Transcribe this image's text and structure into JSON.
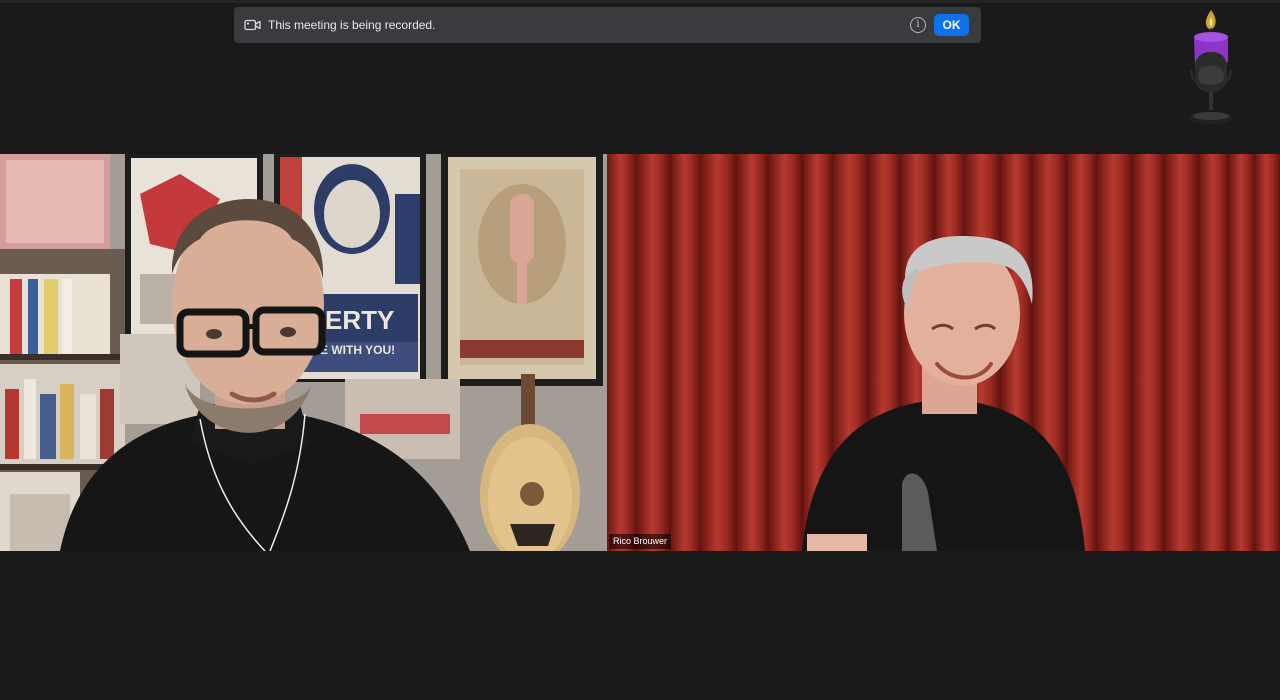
{
  "banner": {
    "icon": "video-camera-icon",
    "message": "This meeting is being recorded.",
    "info_icon": "info-icon",
    "info_glyph": "i",
    "ok_label": "OK"
  },
  "logo": {
    "icon": "microphone-candle-logo-icon"
  },
  "participants": [
    {
      "tile": "left",
      "name": ""
    },
    {
      "tile": "right",
      "name": "Rico Brouwer"
    }
  ],
  "colors": {
    "background": "#1a1a1a",
    "banner_bg": "#3a3b3e",
    "ok_button": "#0e72ed",
    "curtain": "#8a1f1a"
  }
}
